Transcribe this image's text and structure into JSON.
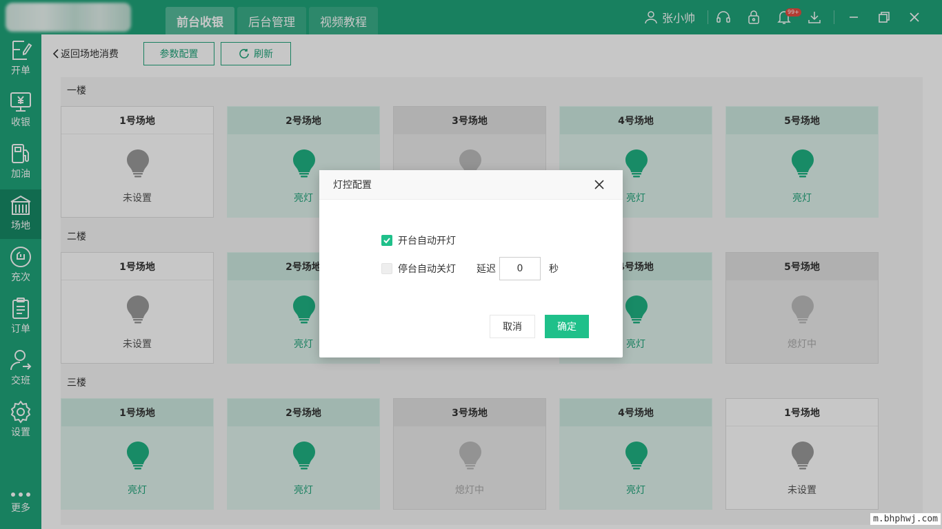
{
  "header": {
    "tabs": [
      {
        "label": "前台收银",
        "active": true
      },
      {
        "label": "后台管理",
        "active": false
      },
      {
        "label": "视频教程",
        "active": false
      }
    ],
    "username": "张小帅",
    "notification_badge": "99+",
    "icons": [
      "user-icon",
      "headset-icon",
      "lock-icon",
      "bell-icon",
      "download-icon",
      "minimize-icon",
      "restore-icon",
      "close-icon"
    ]
  },
  "sidebar": {
    "items": [
      {
        "label": "开单",
        "icon": "edit-icon"
      },
      {
        "label": "收银",
        "icon": "cashier-icon"
      },
      {
        "label": "加油",
        "icon": "fuel-icon"
      },
      {
        "label": "场地",
        "icon": "venue-icon",
        "active": true
      },
      {
        "label": "充次",
        "icon": "recharge-icon"
      },
      {
        "label": "订单",
        "icon": "order-icon"
      },
      {
        "label": "交班",
        "icon": "shift-icon"
      },
      {
        "label": "设置",
        "icon": "settings-icon"
      },
      {
        "label": "更多",
        "icon": "more-icon"
      }
    ]
  },
  "toolbar": {
    "back_label": "返回场地消费",
    "params_label": "参数配置",
    "refresh_label": "刷新"
  },
  "floors": [
    {
      "name": "一楼",
      "venues": [
        {
          "name": "1号场地",
          "status": "未设置",
          "state": "unset"
        },
        {
          "name": "2号场地",
          "status": "亮灯",
          "state": "on"
        },
        {
          "name": "3号场地",
          "status": "",
          "state": "off"
        },
        {
          "name": "4号场地",
          "status": "亮灯",
          "state": "on"
        },
        {
          "name": "5号场地",
          "status": "亮灯",
          "state": "on"
        }
      ]
    },
    {
      "name": "二楼",
      "venues": [
        {
          "name": "1号场地",
          "status": "未设置",
          "state": "unset"
        },
        {
          "name": "2号场地",
          "status": "亮灯",
          "state": "on"
        },
        {
          "name": "",
          "status": "",
          "state": "hidden"
        },
        {
          "name": "4号场地",
          "status": "亮灯",
          "state": "on"
        },
        {
          "name": "5号场地",
          "status": "熄灯中",
          "state": "off"
        }
      ]
    },
    {
      "name": "三楼",
      "venues": [
        {
          "name": "1号场地",
          "status": "亮灯",
          "state": "on"
        },
        {
          "name": "2号场地",
          "status": "亮灯",
          "state": "on"
        },
        {
          "name": "3号场地",
          "status": "熄灯中",
          "state": "off"
        },
        {
          "name": "4号场地",
          "status": "亮灯",
          "state": "on"
        },
        {
          "name": "1号场地",
          "status": "未设置",
          "state": "unset"
        }
      ]
    }
  ],
  "modal": {
    "title": "灯控配置",
    "auto_on_label": "开台自动开灯",
    "auto_on_checked": true,
    "auto_off_label": "停台自动关灯",
    "auto_off_checked": false,
    "delay_label": "延迟",
    "delay_value": "0",
    "delay_unit": "秒",
    "cancel_label": "取消",
    "ok_label": "确定"
  },
  "colors": {
    "brand": "#1fa47a",
    "accent": "#1fc08a",
    "bulb_on": "#1fb383",
    "bulb_off": "#bdbdbd",
    "bulb_unset": "#9a9a9a"
  },
  "watermark": "m.bhphwj.com"
}
